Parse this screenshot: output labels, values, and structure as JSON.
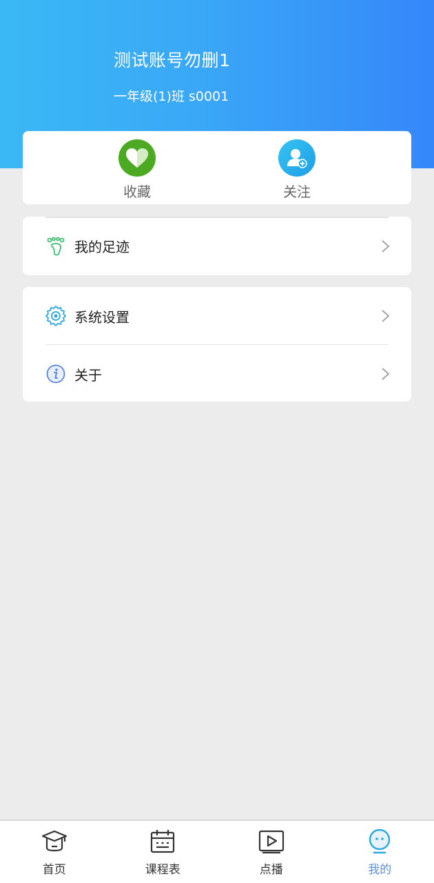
{
  "profile": {
    "name": "测试账号勿删1",
    "class_info": "一年级(1)班 s0001"
  },
  "quick_actions": [
    {
      "label": "收藏",
      "icon": "heart-icon",
      "color": "#4caa22"
    },
    {
      "label": "关注",
      "icon": "user-add-icon",
      "color": "#1f9ee6"
    }
  ],
  "menu": {
    "footprint": {
      "label": "我的足迹",
      "icon": "footprint-icon"
    },
    "settings": {
      "label": "系统设置",
      "icon": "gear-icon"
    },
    "about": {
      "label": "关于",
      "icon": "info-icon"
    }
  },
  "tabs": [
    {
      "label": "首页",
      "icon": "graduation-cap-icon",
      "active": false
    },
    {
      "label": "课程表",
      "icon": "calendar-icon",
      "active": false
    },
    {
      "label": "点播",
      "icon": "play-icon",
      "active": false
    },
    {
      "label": "我的",
      "icon": "profile-face-icon",
      "active": true
    }
  ],
  "colors": {
    "header_start": "#3ab8f5",
    "header_end": "#3587f9",
    "active_tab": "#5a8fd9",
    "background": "#ececec"
  }
}
